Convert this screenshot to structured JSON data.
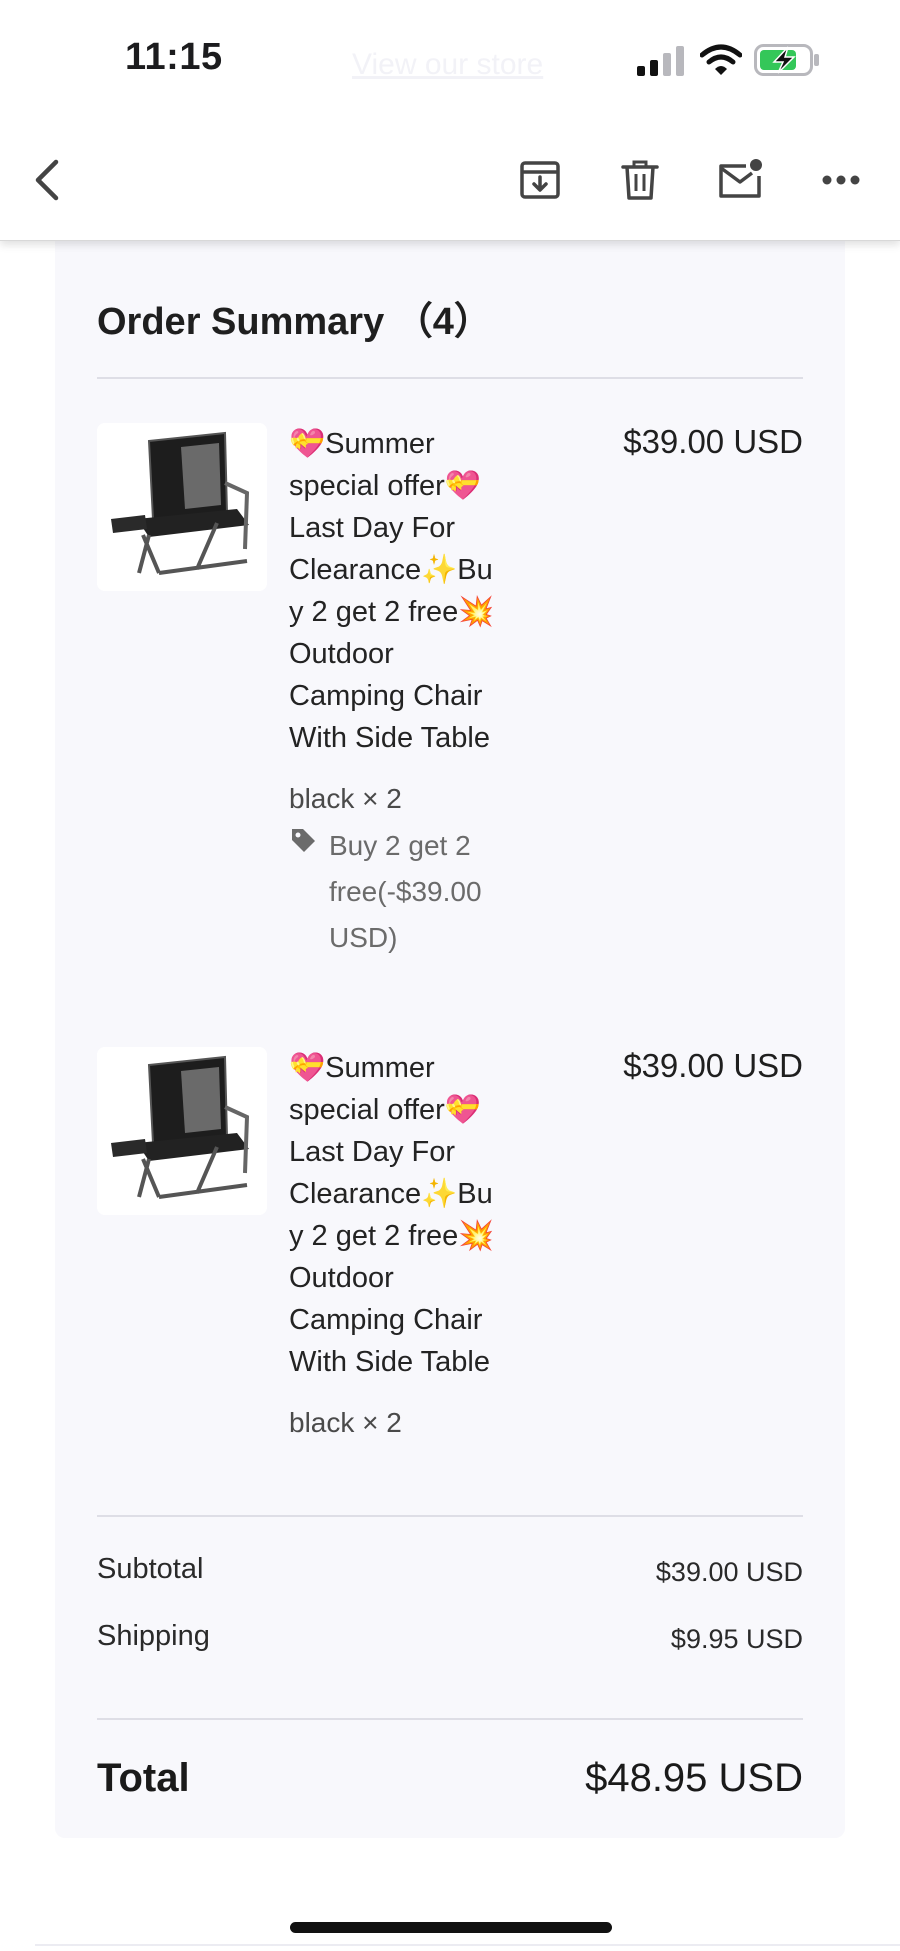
{
  "status_bar": {
    "time": "11:15",
    "ghost_link": "View our store",
    "icons": [
      "cellular-signal-icon",
      "wifi-icon",
      "battery-charging-icon"
    ]
  },
  "toolbar": {
    "icons": [
      "back-chevron-icon",
      "archive-icon",
      "trash-icon",
      "mark-unread-mail-icon",
      "more-icon"
    ]
  },
  "order": {
    "title": "Order Summary （4）",
    "items": [
      {
        "title_lines": [
          "💝Summer",
          "special offer💝",
          "Last Day For",
          "Clearance✨Bu",
          "y 2 get 2 free💥",
          "Outdoor",
          "Camping Chair",
          "With Side Table"
        ],
        "price": "$39.00 USD",
        "variant": "black × 2",
        "discount_lines": [
          "Buy 2 get 2",
          "free(-$39.00",
          "USD)"
        ]
      },
      {
        "title_lines": [
          "💝Summer",
          "special offer💝",
          "Last Day For",
          "Clearance✨Bu",
          "y 2 get 2 free💥",
          "Outdoor",
          "Camping Chair",
          "With Side Table"
        ],
        "price": "$39.00 USD",
        "variant": "black × 2"
      }
    ],
    "subtotal_label": "Subtotal",
    "subtotal_value": "$39.00 USD",
    "shipping_label": "Shipping",
    "shipping_value": "$9.95 USD",
    "total_label": "Total",
    "total_value": "$48.95 USD"
  },
  "colors": {
    "card_bg": "#f8f8fc",
    "battery_green": "#34c759",
    "text": "#1c1c1e",
    "muted": "#6b6b6b"
  }
}
